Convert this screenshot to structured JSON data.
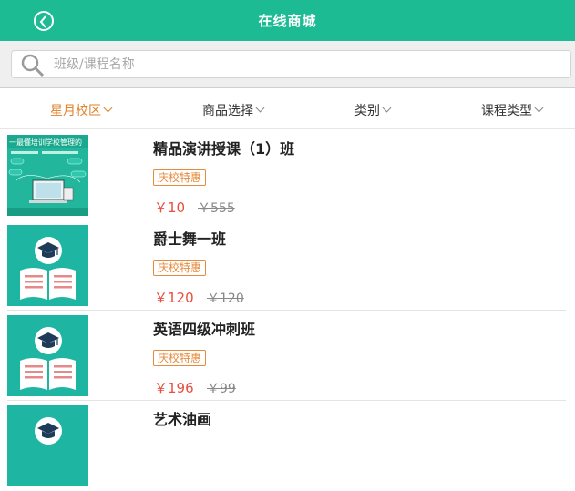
{
  "header": {
    "title": "在线商城"
  },
  "search": {
    "placeholder": "班级/课程名称"
  },
  "filters": [
    {
      "label": "星月校区",
      "active": true
    },
    {
      "label": "商品选择",
      "active": false
    },
    {
      "label": "类别",
      "active": false
    },
    {
      "label": "课程类型",
      "active": false
    }
  ],
  "products": [
    {
      "name": "精品演讲授课（1）班",
      "tag": "庆校特惠",
      "price": "￥10",
      "original_price": "￥555",
      "thumb": "banner-image",
      "thumb_caption": "一最懂培训学校管理的"
    },
    {
      "name": "爵士舞一班",
      "tag": "庆校特惠",
      "price": "￥120",
      "original_price": "￥120",
      "thumb": "graduation-book-icon"
    },
    {
      "name": "英语四级冲刺班",
      "tag": "庆校特惠",
      "price": "￥196",
      "original_price": "￥99",
      "thumb": "graduation-book-icon"
    },
    {
      "name": "艺术油画",
      "tag": "",
      "price": "",
      "original_price": "",
      "thumb": "graduation-book-icon"
    }
  ],
  "colors": {
    "header_bg": "#1dbb94",
    "accent_orange": "#e0822a",
    "price_red": "#e94f3e"
  }
}
